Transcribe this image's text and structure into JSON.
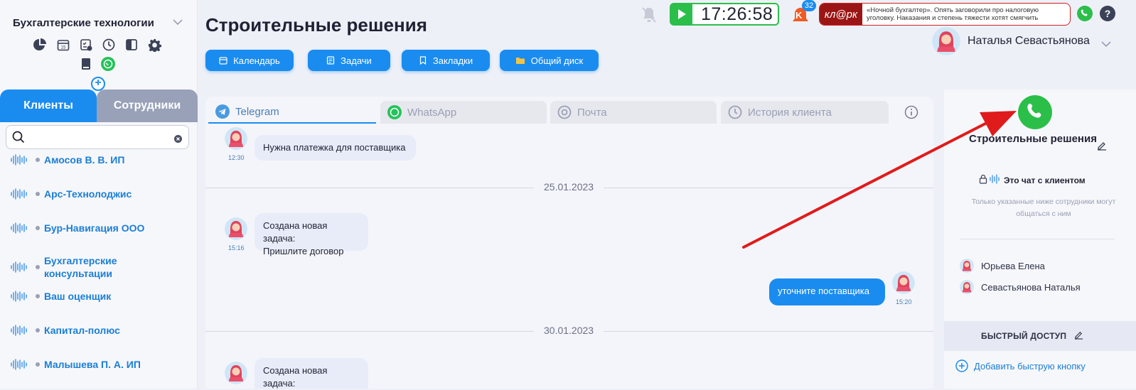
{
  "sidebar": {
    "company": "Бухгалтерские технологии",
    "tabs": {
      "clients": "Клиенты",
      "staff": "Сотрудники"
    },
    "search": {
      "value": "",
      "placeholder": ""
    },
    "clients": [
      "Амосов В. В. ИП",
      "Арс-Технолоджис",
      "Бур-Навигация ООО",
      "Бухгалтерские консультации",
      "Ваш оценщик",
      "Капитал-полюс",
      "Малышева П. А. ИП"
    ]
  },
  "header": {
    "title": "Строительные решения",
    "buttons": {
      "calendar": "Календарь",
      "tasks": "Задачи",
      "bookmarks": "Закладки",
      "disk": "Общий диск"
    },
    "timer": "17:26:58",
    "notifications_count": "32",
    "notifications_letter": "K",
    "ad": {
      "logo": "кл@рк",
      "text": "«Ночной бухгалтер». Опять заговорили про налоговую уголовку. Наказания и степень тяжести хотят смягчить"
    },
    "user_name": "Наталья Севастьянова"
  },
  "chat": {
    "tabs": {
      "telegram": "Telegram",
      "whatsapp": "WhatsApp",
      "mail": "Почта",
      "history": "История клиента"
    },
    "messages": [
      {
        "text": "Нужна платежка для поставщика",
        "time": "12:30"
      },
      {
        "text_line1": "Создана новая задача:",
        "text_line2": "Пришлите договор",
        "time": "15:16"
      },
      {
        "text": "уточните поставщика",
        "time": "15:20"
      },
      {
        "text": "Создана новая задача:"
      }
    ],
    "dates": [
      "25.01.2023",
      "30.01.2023"
    ]
  },
  "right_panel": {
    "client_name": "Строительные решения",
    "chat_label": "Это чат с клиентом",
    "description": "Только указанные ниже сотрудники могут общаться с ним",
    "employees": [
      "Юрьева Елена",
      "Севастьянова Наталья"
    ],
    "quick_access_title": "БЫСТРЫЙ ДОСТУП",
    "add_quick_button": "Добавить быструю кнопку"
  },
  "colors": {
    "accent": "#1a8cf0",
    "green": "#2bbf4a",
    "arrow": "#e01b1b",
    "ad_red": "#9c1515"
  }
}
